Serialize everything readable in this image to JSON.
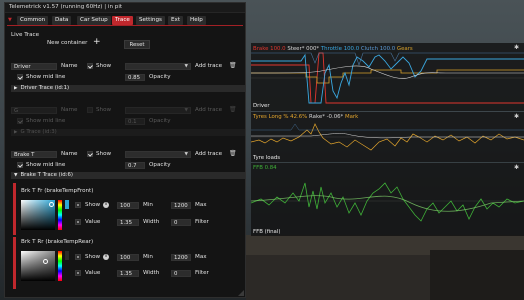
{
  "window": {
    "title": "Telemetrick v1.57  (running 60Hz) | in pit"
  },
  "tabs": [
    {
      "label": "Common"
    },
    {
      "label": "Data"
    },
    {
      "label": "Car Setup"
    },
    {
      "label": "Trace",
      "active": true
    },
    {
      "label": "Settings"
    },
    {
      "label": "Ext"
    },
    {
      "label": "Help"
    }
  ],
  "live_trace": {
    "section_label": "Live Trace",
    "new_container_label": "New container",
    "reset_label": "Reset"
  },
  "containers": [
    {
      "name_value": "Driver",
      "name_label": "Name",
      "show_label": "Show",
      "add_trace_label": "Add trace",
      "show_mid_line_label": "Show mid line",
      "opacity_value": "0.85",
      "opacity_label": "Opacity",
      "header": "Driver Trace (id:1)",
      "enabled": true
    },
    {
      "name_value": "G",
      "name_label": "Name",
      "show_label": "Show",
      "add_trace_label": "Add trace",
      "show_mid_line_label": "Show mid line",
      "opacity_value": "0.1",
      "opacity_label": "Opacity",
      "header": "G Trace (id:3)",
      "enabled": false
    },
    {
      "name_value": "Brake T",
      "name_label": "Name",
      "show_label": "Show",
      "add_trace_label": "Add trace",
      "show_mid_line_label": "Show mid line",
      "opacity_value": "0.7",
      "opacity_label": "Opacity",
      "header": "Brake T Trace (id:6)",
      "enabled": true
    }
  ],
  "brake_traces": [
    {
      "title": "Brk T Fr (brakeTempFront)",
      "show_label": "Show",
      "min_value": "100",
      "min_label": "Min",
      "max_value": "1200",
      "max_label": "Max",
      "value_label": "Value",
      "width_value": "1.35",
      "width_label": "Width",
      "filter_value": "0",
      "filter_label": "Filter",
      "color": "#2ea8d8"
    },
    {
      "title": "Brk T Rr (brakeTempRear)",
      "show_label": "Show",
      "min_value": "100",
      "min_label": "Min",
      "max_value": "1200",
      "max_label": "Max",
      "value_label": "Value",
      "width_value": "1.35",
      "width_label": "Width",
      "filter_value": "0",
      "filter_label": "Filter",
      "color": "#2a2a2a"
    }
  ],
  "plots": {
    "driver": {
      "legend": [
        {
          "text": "Brake 100.0",
          "color": "#e0362e"
        },
        {
          "text": "Steer* 000*",
          "color": "#d8d8d8"
        },
        {
          "text": "Throttle 100.0",
          "color": "#3aa8e0"
        },
        {
          "text": "Clutch 100.0",
          "color": "#5c9bd6"
        },
        {
          "text": "Gears",
          "color": "#d7a12a"
        }
      ],
      "name": "Driver"
    },
    "tyre": {
      "legend": [
        {
          "text": "Tyres Long % 42.6%",
          "color": "#e3a52c"
        },
        {
          "text": "Rake* -0.06*",
          "color": "#d8d8d8"
        },
        {
          "text": "Mark",
          "color": "#e3a52c"
        }
      ],
      "name": "Tyre loads"
    },
    "ffb": {
      "legend": [
        {
          "text": "FFB 0.84",
          "color": "#3fb038"
        }
      ],
      "name": "FFB (final)"
    }
  },
  "icons": {
    "trash": "trash-icon",
    "info": "info-icon",
    "gear": "gear-icon",
    "plus": "plus-icon",
    "arrow": "chevron-down-icon"
  },
  "colors": {
    "accent": "#c0282d",
    "panel_bg": "#141414",
    "brake": "#e0362e",
    "throttle": "#3aa8e0",
    "tyre": "#e3a52c",
    "ffb": "#3fb038"
  }
}
